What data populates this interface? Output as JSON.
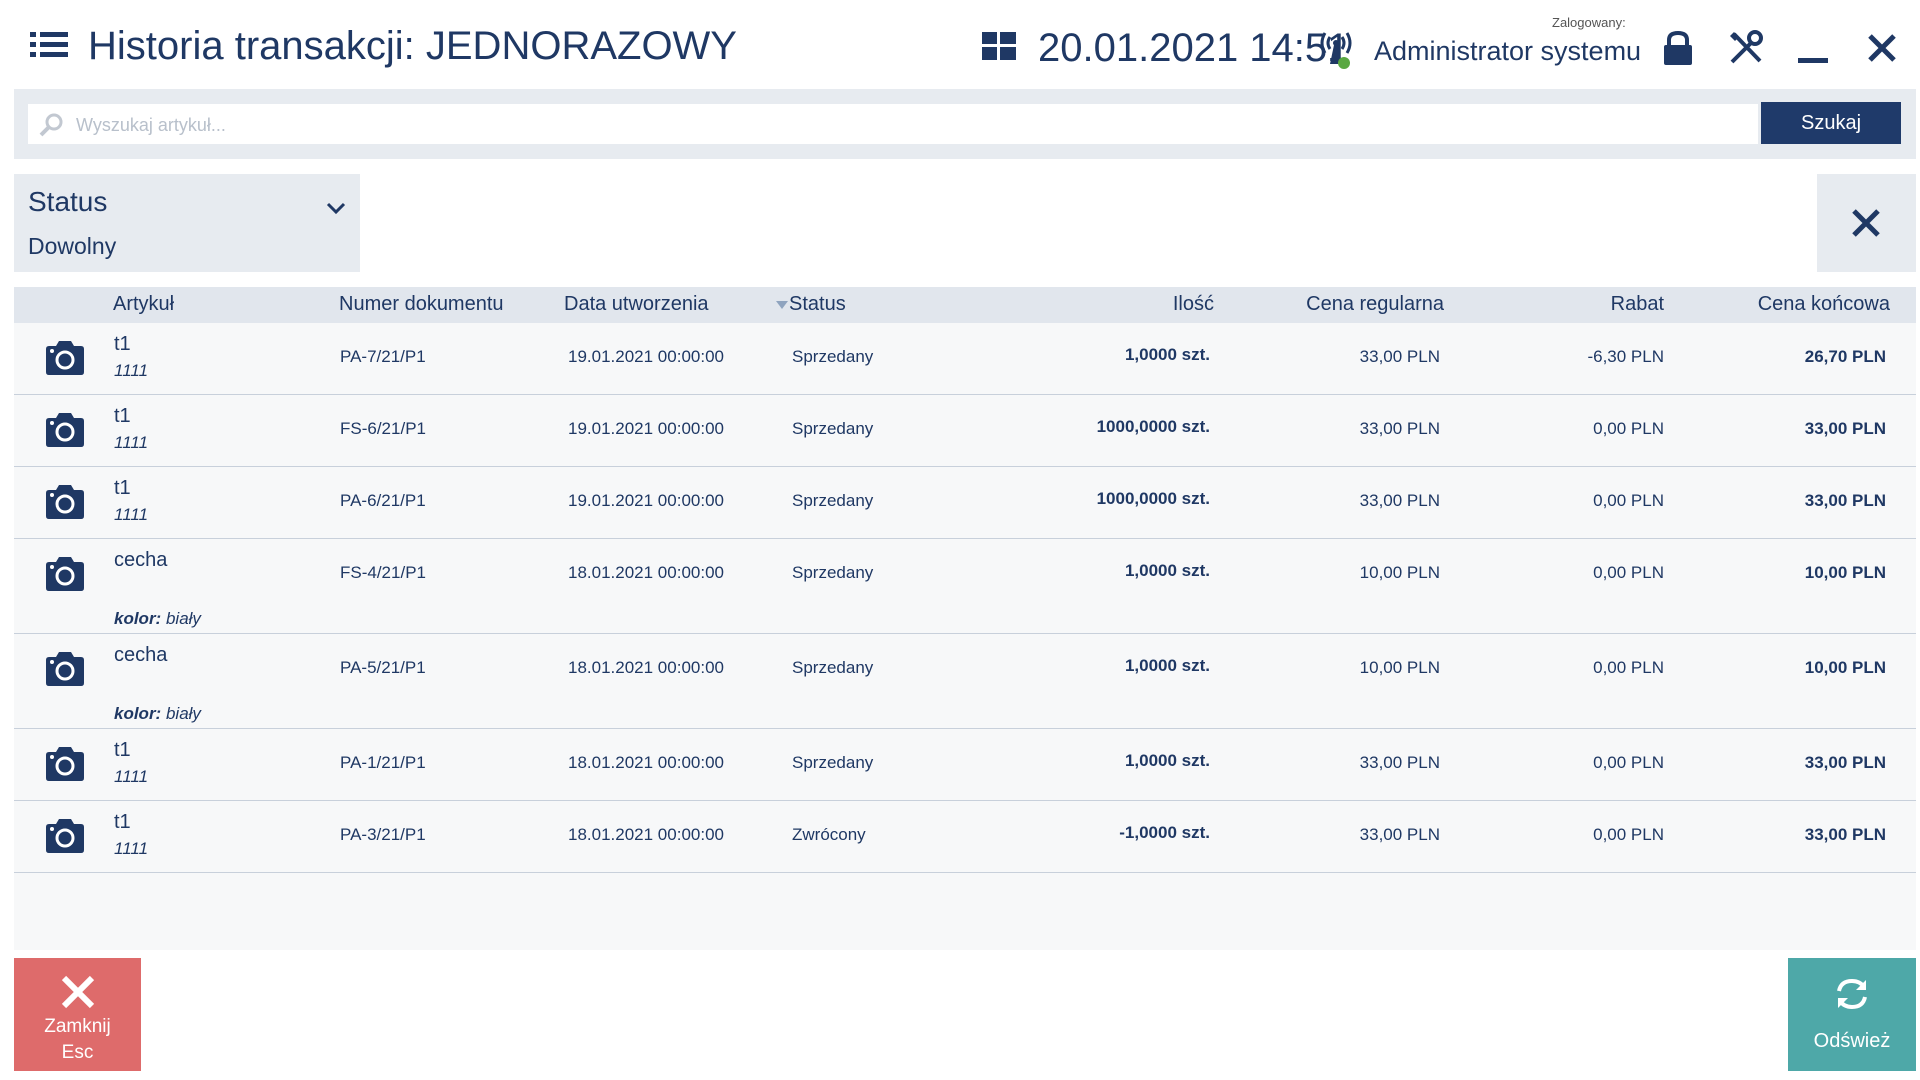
{
  "header": {
    "title": "Historia transakcji: JEDNORAZOWY",
    "datetime": "20.01.2021 14:51",
    "logged_label": "Zalogowany:",
    "user": "Administrator systemu"
  },
  "search": {
    "placeholder": "Wyszukaj artykuł...",
    "button": "Szukaj"
  },
  "filter": {
    "label": "Status",
    "value": "Dowolny"
  },
  "table": {
    "columns": {
      "artykul": "Artykuł",
      "numer": "Numer dokumentu",
      "data": "Data utworzenia",
      "status": "Status",
      "ilosc": "Ilość",
      "cena_reg": "Cena regularna",
      "rabat": "Rabat",
      "cena_konc": "Cena końcowa"
    },
    "rows": [
      {
        "name": "t1",
        "code": "1111",
        "feature_key": "",
        "feature_val": "",
        "doc": "PA-7/21/P1",
        "date": "19.01.2021 00:00:00",
        "status": "Sprzedany",
        "qty": "1,0000 szt.",
        "price": "33,00 PLN",
        "discount": "-6,30 PLN",
        "final": "26,70 PLN"
      },
      {
        "name": "t1",
        "code": "1111",
        "feature_key": "",
        "feature_val": "",
        "doc": "FS-6/21/P1",
        "date": "19.01.2021 00:00:00",
        "status": "Sprzedany",
        "qty": "1000,0000 szt.",
        "price": "33,00 PLN",
        "discount": "0,00 PLN",
        "final": "33,00 PLN"
      },
      {
        "name": "t1",
        "code": "1111",
        "feature_key": "",
        "feature_val": "",
        "doc": "PA-6/21/P1",
        "date": "19.01.2021 00:00:00",
        "status": "Sprzedany",
        "qty": "1000,0000 szt.",
        "price": "33,00 PLN",
        "discount": "0,00 PLN",
        "final": "33,00 PLN"
      },
      {
        "name": "cecha",
        "code": "",
        "feature_key": "kolor:",
        "feature_val": " biały",
        "doc": "FS-4/21/P1",
        "date": "18.01.2021 00:00:00",
        "status": "Sprzedany",
        "qty": "1,0000 szt.",
        "price": "10,00 PLN",
        "discount": "0,00 PLN",
        "final": "10,00 PLN"
      },
      {
        "name": "cecha",
        "code": "",
        "feature_key": "kolor:",
        "feature_val": " biały",
        "doc": "PA-5/21/P1",
        "date": "18.01.2021 00:00:00",
        "status": "Sprzedany",
        "qty": "1,0000 szt.",
        "price": "10,00 PLN",
        "discount": "0,00 PLN",
        "final": "10,00 PLN"
      },
      {
        "name": "t1",
        "code": "1111",
        "feature_key": "",
        "feature_val": "",
        "doc": "PA-1/21/P1",
        "date": "18.01.2021 00:00:00",
        "status": "Sprzedany",
        "qty": "1,0000 szt.",
        "price": "33,00 PLN",
        "discount": "0,00 PLN",
        "final": "33,00 PLN"
      },
      {
        "name": "t1",
        "code": "1111",
        "feature_key": "",
        "feature_val": "",
        "doc": "PA-3/21/P1",
        "date": "18.01.2021 00:00:00",
        "status": "Zwrócony",
        "qty": "-1,0000 szt.",
        "price": "33,00 PLN",
        "discount": "0,00 PLN",
        "final": "33,00 PLN"
      }
    ]
  },
  "footer": {
    "close_label": "Zamknij",
    "close_key": "Esc",
    "refresh_label": "Odśwież"
  },
  "colors": {
    "accent": "#1f3864",
    "close": "#de6b6b",
    "refresh": "#4ea8a8"
  },
  "icons": [
    "menu-icon",
    "tiles-icon",
    "signal-icon",
    "lock-icon",
    "tools-icon",
    "minimize-icon",
    "close-icon",
    "search-icon",
    "chevron-down-icon",
    "camera-icon",
    "refresh-icon"
  ]
}
